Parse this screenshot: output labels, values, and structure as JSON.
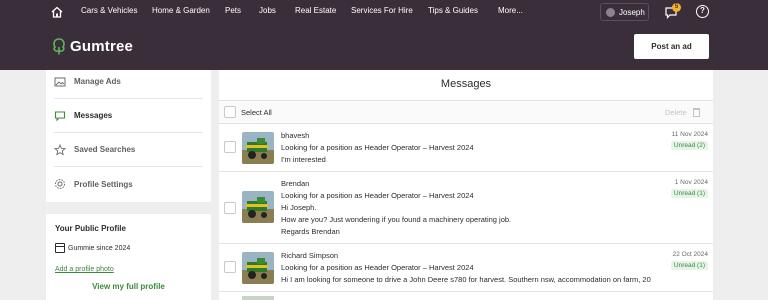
{
  "nav": {
    "links": [
      "Cars & Vehicles",
      "Home & Garden",
      "Pets",
      "Jobs",
      "Real Estate",
      "Services For Hire",
      "Tips & Guides",
      "More..."
    ],
    "user_name": "Joseph",
    "notification_count": "5",
    "help_glyph": "?"
  },
  "header": {
    "logo_text": "Gumtree",
    "post_ad_label": "Post an ad"
  },
  "sidebar": {
    "items": [
      {
        "label": "Manage Ads",
        "icon": "image-icon"
      },
      {
        "label": "Messages",
        "icon": "chat-icon"
      },
      {
        "label": "Saved Searches",
        "icon": "star-icon"
      },
      {
        "label": "Profile Settings",
        "icon": "gear-icon"
      }
    ],
    "active_index": 1
  },
  "profile": {
    "title": "Your Public Profile",
    "since": "Gummie since 2024",
    "add_photo": "Add a profile photo",
    "view_full": "View my full profile"
  },
  "messages": {
    "title": "Messages",
    "select_all": "Select All",
    "delete_label": "Delete",
    "rows": [
      {
        "sender": "bhavesh",
        "subject": "Looking for a position as Header Operator – Harvest 2024",
        "lines": [
          "I'm interested"
        ],
        "date": "11 Nov 2024",
        "status": "Unread (2)"
      },
      {
        "sender": "Brendan",
        "subject": "Looking for a position as Header Operator – Harvest 2024",
        "lines": [
          "Hi Joseph.",
          "How are you? Just wondering if you found a machinery operating job.",
          "Regards Brendan"
        ],
        "date": "1 Nov 2024",
        "status": "Unread (1)"
      },
      {
        "sender": "Richard Simpson",
        "subject": "Looking for a position as Header Operator – Harvest 2024",
        "lines": [
          "Hi I am looking for someone to drive a John Deere s780 for harvest. Southern nsw, accommodation on farm, 20"
        ],
        "date": "22 Oct 2024",
        "status": "Unread (1)"
      }
    ]
  },
  "colors": {
    "brand_dark": "#3a2e3b",
    "brand_green": "#3c8a3c",
    "badge_yellow": "#f5b324"
  }
}
